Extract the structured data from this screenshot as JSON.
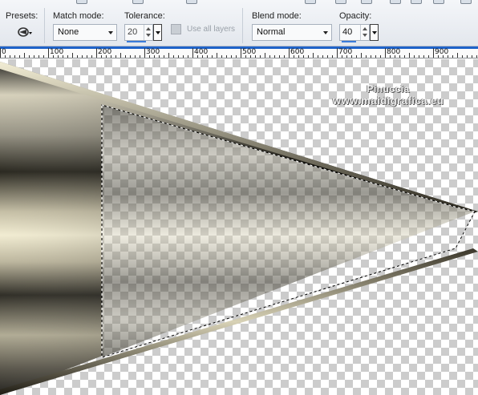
{
  "toolbar": {
    "presets_label": "Presets:",
    "match_mode": {
      "label": "Match mode:",
      "value": "None"
    },
    "tolerance": {
      "label": "Tolerance:",
      "value": "20"
    },
    "use_all_layers": {
      "label": "Use all layers",
      "checked": false
    },
    "blend_mode": {
      "label": "Blend mode:",
      "value": "Normal"
    },
    "opacity": {
      "label": "Opacity:",
      "value": "40"
    }
  },
  "ruler": {
    "ticks": [
      "0",
      "100",
      "200",
      "300",
      "400",
      "500",
      "600",
      "700",
      "800",
      "900"
    ]
  },
  "canvas": {
    "watermark_line1": "Pinuccia",
    "watermark_line2": "www.maidigrafica.eu"
  },
  "colors": {
    "accent": "#1f63c9",
    "selection": "#ffffff"
  }
}
